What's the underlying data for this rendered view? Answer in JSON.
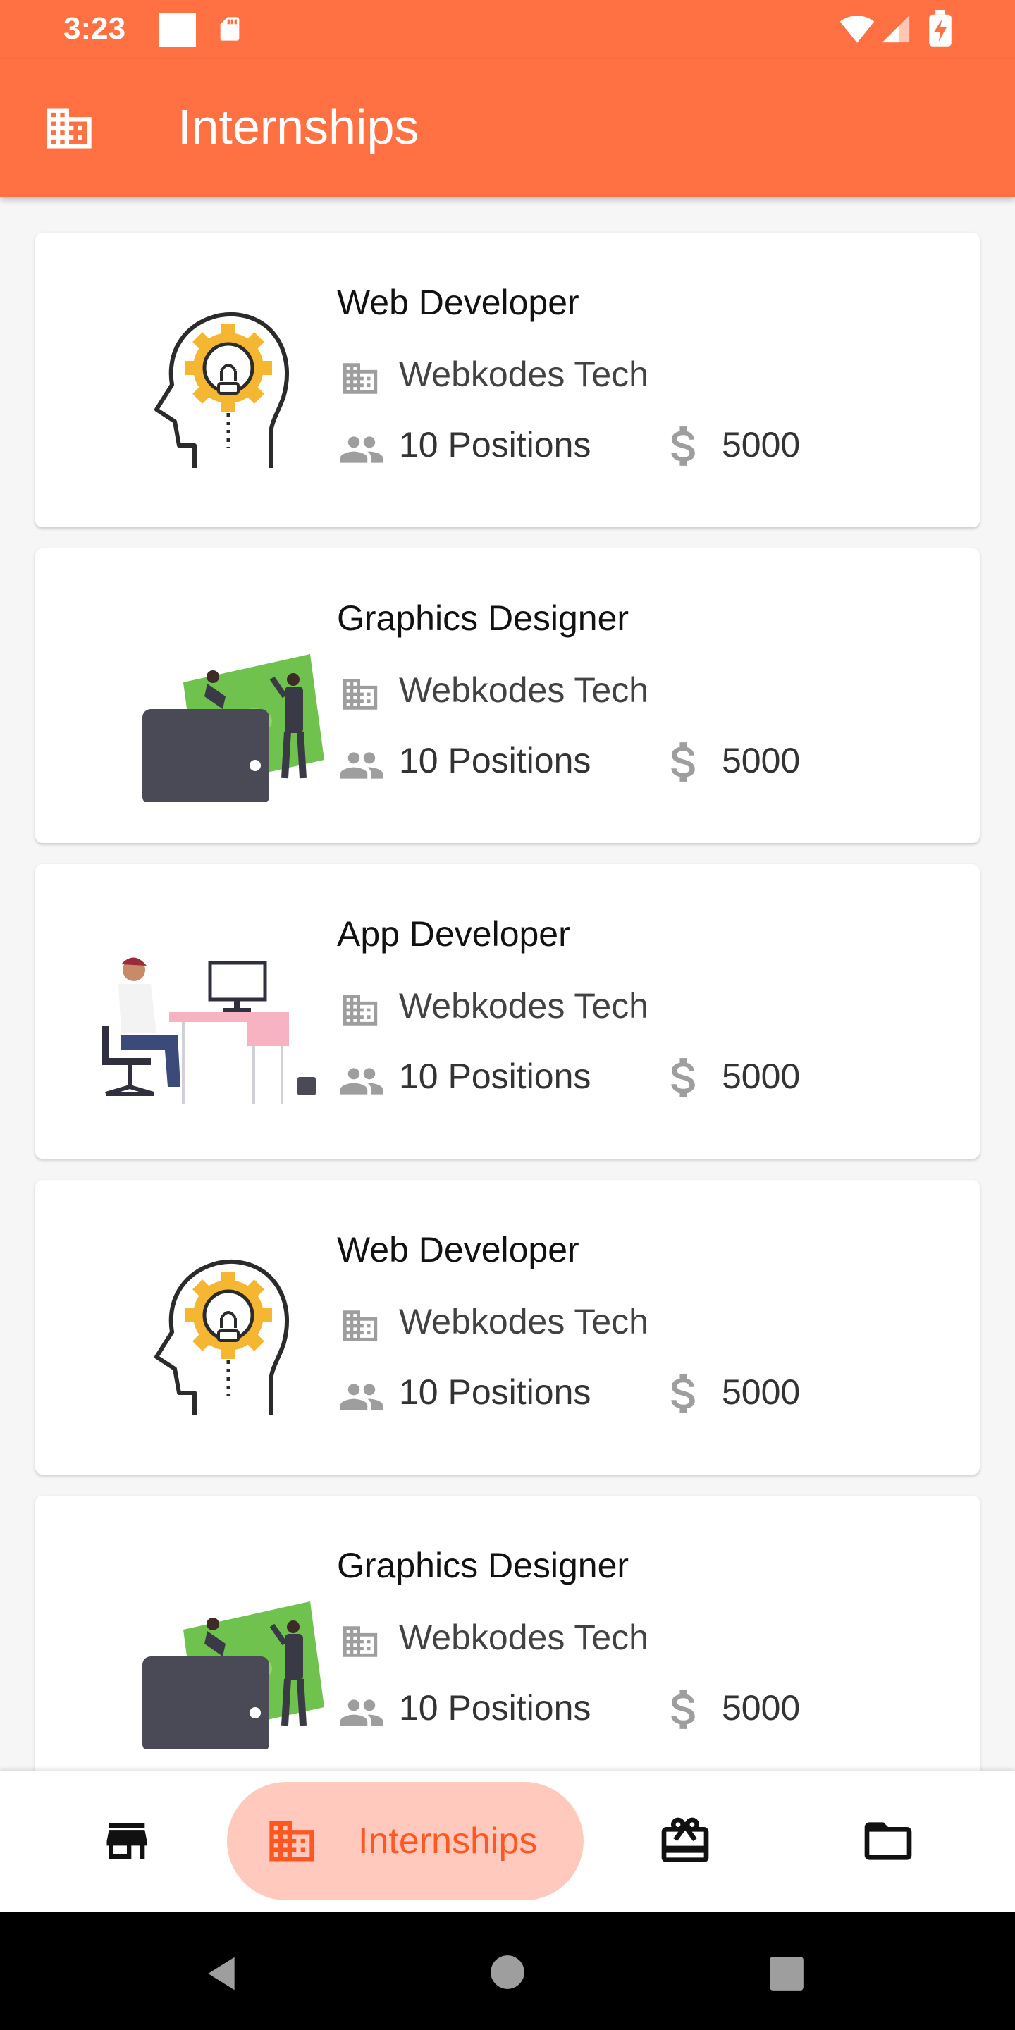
{
  "status_bar": {
    "time": "3:23"
  },
  "app_bar": {
    "title": "Internships",
    "icon": "building-icon"
  },
  "internships": [
    {
      "title": "Web Developer",
      "company": "Webkodes Tech",
      "positions": "10 Positions",
      "stipend": "5000",
      "illustration": "lightbulb-head"
    },
    {
      "title": "Graphics Designer",
      "company": "Webkodes Tech",
      "positions": "10 Positions",
      "stipend": "5000",
      "illustration": "wallet-money"
    },
    {
      "title": "App Developer",
      "company": "Webkodes Tech",
      "positions": "10 Positions",
      "stipend": "5000",
      "illustration": "person-at-desk"
    },
    {
      "title": "Web Developer",
      "company": "Webkodes Tech",
      "positions": "10 Positions",
      "stipend": "5000",
      "illustration": "lightbulb-head"
    },
    {
      "title": "Graphics Designer",
      "company": "Webkodes Tech",
      "positions": "10 Positions",
      "stipend": "5000",
      "illustration": "wallet-money"
    }
  ],
  "bottom_nav": {
    "items": [
      {
        "icon": "store-icon"
      },
      {
        "icon": "building-icon",
        "label": "Internships",
        "selected": true
      },
      {
        "icon": "gift-card-icon"
      },
      {
        "icon": "folder-icon"
      }
    ]
  },
  "colors": {
    "primary": "#ff7043",
    "selected_pill": "#ffcabd",
    "selected_text": "#ff5722"
  }
}
